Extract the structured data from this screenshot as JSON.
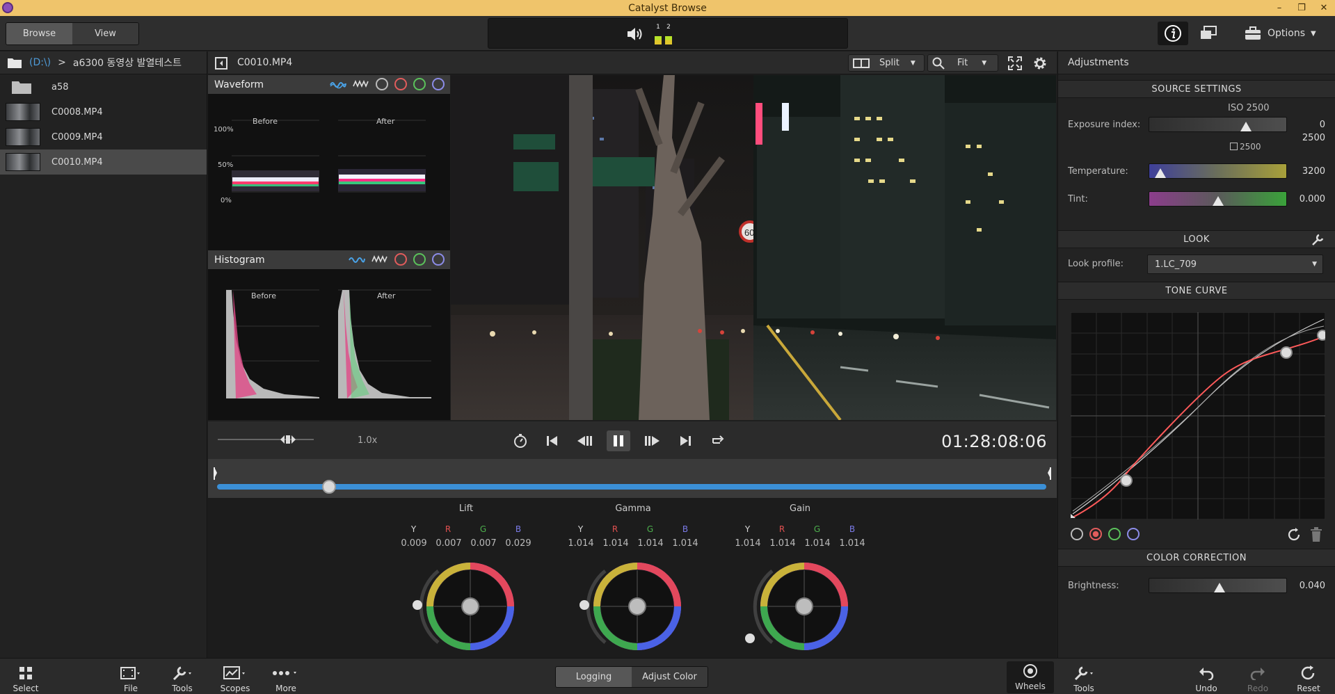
{
  "window": {
    "title": "Catalyst Browse",
    "minimize": "–",
    "restore": "❐",
    "close": "✕"
  },
  "toolbar": {
    "browse": "Browse",
    "view": "View",
    "meter_1": "1",
    "meter_2": "2",
    "options": "Options"
  },
  "browser": {
    "drive": "(D:\\)",
    "separator": ">",
    "folder": "a6300 동영상 발열테스트",
    "items": [
      {
        "name": "a58",
        "type": "folder"
      },
      {
        "name": "C0008.MP4",
        "type": "clip"
      },
      {
        "name": "C0009.MP4",
        "type": "clip"
      },
      {
        "name": "C0010.MP4",
        "type": "clip",
        "selected": true
      }
    ]
  },
  "viewer": {
    "clip_name": "C0010.MP4",
    "split_label": "Split",
    "fit_label": "Fit",
    "speed": "1.0x",
    "timecode": "01:28:08:06",
    "playhead_fraction": 0.135
  },
  "scopes": {
    "waveform": {
      "title": "Waveform",
      "before": "Before",
      "after": "After",
      "pct_100": "100%",
      "pct_50": "50%",
      "pct_0": "0%"
    },
    "histogram": {
      "title": "Histogram",
      "before": "Before",
      "after": "After"
    }
  },
  "wheels": {
    "channels": {
      "y": "Y",
      "r": "R",
      "g": "G",
      "b": "B"
    },
    "lift": {
      "title": "Lift",
      "y": "0.009",
      "r": "0.007",
      "g": "0.007",
      "b": "0.029"
    },
    "gamma": {
      "title": "Gamma",
      "y": "1.014",
      "r": "1.014",
      "g": "1.014",
      "b": "1.014"
    },
    "gain": {
      "title": "Gain",
      "y": "1.014",
      "r": "1.014",
      "g": "1.014",
      "b": "1.014"
    }
  },
  "adjustments": {
    "title": "Adjustments",
    "source_settings": "SOURCE SETTINGS",
    "iso": "ISO 2500",
    "exposure_label": "Exposure index:",
    "exposure_value": "0",
    "exposure_value2": "2500",
    "exposure_marker": "2500",
    "temperature_label": "Temperature:",
    "temperature_value": "3200",
    "tint_label": "Tint:",
    "tint_value": "0.000",
    "look": "LOOK",
    "look_profile_label": "Look profile:",
    "look_profile_value": "1.LC_709",
    "tone_curve": "TONE CURVE",
    "color_correction": "COLOR CORRECTION",
    "brightness_label": "Brightness:",
    "brightness_value": "0.040"
  },
  "bottom": {
    "select": "Select",
    "file": "File",
    "tools": "Tools",
    "scopes": "Scopes",
    "more": "More",
    "logging": "Logging",
    "adjust_color": "Adjust Color",
    "wheels": "Wheels",
    "tools_right": "Tools",
    "undo": "Undo",
    "redo": "Redo",
    "reset": "Reset"
  },
  "colors": {
    "accent_blue": "#3b8fd6",
    "title_bar": "#efc46b",
    "curve_red": "#ff5a5a"
  }
}
